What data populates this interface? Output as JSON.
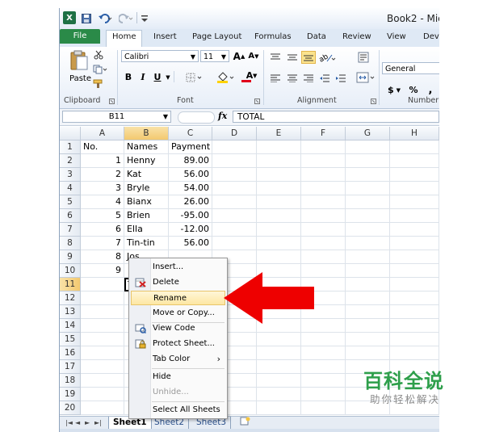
{
  "window": {
    "title": "Book2 - Micr"
  },
  "quick_access": {
    "logo": "X",
    "undo_icon": "undo-icon",
    "redo_icon": "redo-icon",
    "save_icon": "save-icon"
  },
  "tabs": [
    "File",
    "Home",
    "Insert",
    "Page Layout",
    "Formulas",
    "Data",
    "Review",
    "View",
    "Deve"
  ],
  "ribbon": {
    "paste_label": "Paste",
    "font_name": "Calibri",
    "font_size": "11",
    "bold": "B",
    "italic": "I",
    "underline": "U",
    "grow_font": "A",
    "shrink_font": "A",
    "font_color_glyph": "A",
    "number_format": "General",
    "currency": "$",
    "percent": "%",
    "comma": ",",
    "groups": {
      "clipboard": "Clipboard",
      "font": "Font",
      "alignment": "Alignment",
      "number": "Number"
    },
    "accent_colors": {
      "fill": "#ffd200",
      "font_color": "#e0001b",
      "file_tab": "#2a8a48"
    }
  },
  "formula_bar": {
    "name_box": "B11",
    "fx": "fx",
    "content": "TOTAL"
  },
  "grid": {
    "columns": [
      "A",
      "B",
      "C",
      "D",
      "E",
      "F",
      "G",
      "H"
    ],
    "active_column": "B",
    "active_row": "11",
    "rows": [
      {
        "n": "1",
        "a": "No.",
        "b": "Names",
        "c": "Payment"
      },
      {
        "n": "2",
        "a": "1",
        "b": "Henny",
        "c": "89.00"
      },
      {
        "n": "3",
        "a": "2",
        "b": "Kat",
        "c": "56.00"
      },
      {
        "n": "4",
        "a": "3",
        "b": "Bryle",
        "c": "54.00"
      },
      {
        "n": "5",
        "a": "4",
        "b": "Bianx",
        "c": "26.00"
      },
      {
        "n": "6",
        "a": "5",
        "b": "Brien",
        "c": "-95.00"
      },
      {
        "n": "7",
        "a": "6",
        "b": "Ella",
        "c": "-12.00"
      },
      {
        "n": "8",
        "a": "7",
        "b": "Tin-tin",
        "c": "56.00"
      },
      {
        "n": "9",
        "a": "8",
        "b": "Jos",
        "c": ""
      },
      {
        "n": "10",
        "a": "9",
        "b": "",
        "c": ""
      },
      {
        "n": "11",
        "a": "",
        "b": "T",
        "c": ""
      },
      {
        "n": "12",
        "a": "",
        "b": "",
        "c": ""
      },
      {
        "n": "13",
        "a": "",
        "b": "",
        "c": ""
      },
      {
        "n": "14",
        "a": "",
        "b": "",
        "c": ""
      },
      {
        "n": "15",
        "a": "",
        "b": "",
        "c": ""
      },
      {
        "n": "16",
        "a": "",
        "b": "",
        "c": ""
      },
      {
        "n": "17",
        "a": "",
        "b": "",
        "c": ""
      },
      {
        "n": "18",
        "a": "",
        "b": "",
        "c": ""
      },
      {
        "n": "19",
        "a": "",
        "b": "",
        "c": ""
      },
      {
        "n": "20",
        "a": "",
        "b": "",
        "c": ""
      }
    ]
  },
  "sheet_tabs": [
    "Sheet1",
    "Sheet2",
    "Sheet3"
  ],
  "active_sheet": "Sheet1",
  "context_menu": {
    "items": [
      {
        "label": "Insert...",
        "icon": "",
        "state": "normal"
      },
      {
        "label": "Delete",
        "icon": "delete-sheet-icon",
        "state": "normal"
      },
      {
        "label": "Rename",
        "icon": "",
        "state": "highlighted"
      },
      {
        "label": "Move or Copy...",
        "icon": "",
        "state": "normal"
      },
      {
        "label": "View Code",
        "icon": "view-code-icon",
        "state": "normal"
      },
      {
        "label": "Protect Sheet...",
        "icon": "protect-sheet-icon",
        "state": "normal"
      },
      {
        "label": "Tab Color",
        "icon": "",
        "state": "submenu"
      },
      {
        "label": "Hide",
        "icon": "",
        "state": "normal"
      },
      {
        "label": "Unhide...",
        "icon": "",
        "state": "disabled"
      },
      {
        "label": "Select All Sheets",
        "icon": "",
        "state": "normal"
      }
    ],
    "submenu_glyph": "›"
  },
  "annotation": {
    "arrow_color": "#ee0000"
  },
  "watermark": {
    "main": "百科全说",
    "sub": "助你轻松解决"
  }
}
